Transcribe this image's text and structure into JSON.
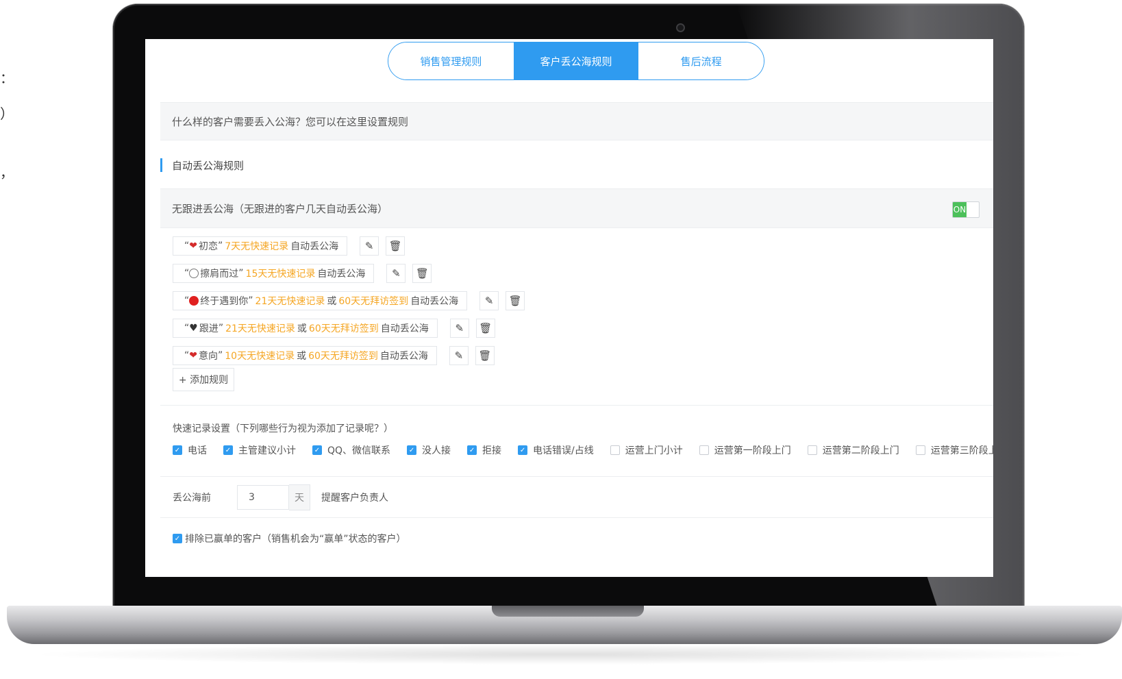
{
  "edge_fragments": [
    "：",
    "）",
    "，"
  ],
  "tabs": [
    {
      "label": "销售管理规则",
      "active": false
    },
    {
      "label": "客户丢公海规则",
      "active": true
    },
    {
      "label": "售后流程",
      "active": false
    }
  ],
  "banner": "什么样的客户需要丢入公海？您可以在这里设置规则",
  "section_title": "自动丢公海规则",
  "rule_header": {
    "label": "无跟进丢公海（无跟进的客户几天自动丢公海）",
    "toggle_label": "ON",
    "toggle_on": true
  },
  "rules": [
    {
      "icon": "heart-icon",
      "icon_glyph": "❤",
      "name": "初恋",
      "cond1": "7天无快速记录",
      "or_text": "",
      "cond2": "",
      "suffix": "自动丢公海",
      "open_quote": "“",
      "close_quote": "”"
    },
    {
      "icon": "circle-empty-icon",
      "icon_glyph": "",
      "name": "擦肩而过",
      "cond1": "15天无快速记录",
      "or_text": "",
      "cond2": "",
      "suffix": "自动丢公海",
      "open_quote": "“",
      "close_quote": "”"
    },
    {
      "icon": "circle-red-icon",
      "icon_glyph": "",
      "name": "终于遇到你",
      "cond1": "21天无快速记录",
      "or_text": "或",
      "cond2": "60天无拜访签到",
      "suffix": "自动丢公海",
      "open_quote": "“",
      "close_quote": "”"
    },
    {
      "icon": "heart-dark-icon",
      "icon_glyph": "♥",
      "name": "跟进",
      "cond1": "21天无快速记录",
      "or_text": "或",
      "cond2": "60天无拜访签到",
      "suffix": "自动丢公海",
      "open_quote": "“",
      "close_quote": "”"
    },
    {
      "icon": "heart-icon",
      "icon_glyph": "❤",
      "name": "意向",
      "cond1": "10天无快速记录",
      "or_text": "或",
      "cond2": "60天无拜访签到",
      "suffix": "自动丢公海",
      "open_quote": "“",
      "close_quote": "”"
    }
  ],
  "edit_glyph": "✎",
  "delete_glyph": "🗑",
  "add_rule_label": "+ 添加规则",
  "quick_record": {
    "title": "快速记录设置（下列哪些行为视为添加了记录呢？）",
    "options": [
      {
        "label": "电话",
        "checked": true
      },
      {
        "label": "主管建议小计",
        "checked": true
      },
      {
        "label": "QQ、微信联系",
        "checked": true
      },
      {
        "label": "没人接",
        "checked": true
      },
      {
        "label": "拒接",
        "checked": true
      },
      {
        "label": "电话错误/占线",
        "checked": true
      },
      {
        "label": "运营上门小计",
        "checked": false
      },
      {
        "label": "运营第一阶段上门",
        "checked": false
      },
      {
        "label": "运营第二阶段上门",
        "checked": false
      },
      {
        "label": "运营第三阶段上门",
        "checked": false
      }
    ]
  },
  "remind": {
    "prefix": "丢公海前",
    "value": "3",
    "unit": "天",
    "suffix": "提醒客户负责人"
  },
  "exclude": {
    "label": "排除已赢单的客户（销售机会为“赢单”状态的客户）",
    "checked": true
  },
  "colors": {
    "accent": "#2f9bf0",
    "highlight": "#f5a623",
    "toggle_on": "#4cc05a"
  }
}
